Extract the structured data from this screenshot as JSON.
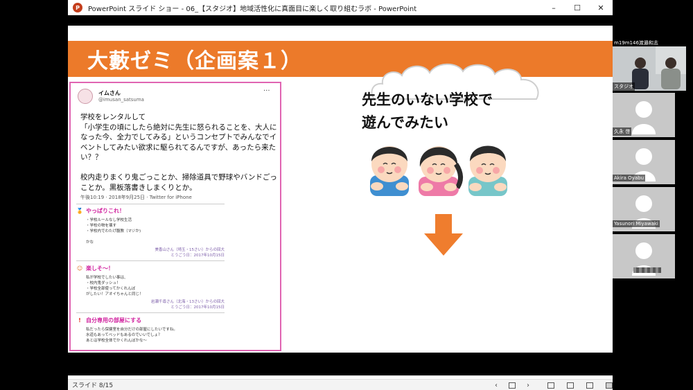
{
  "window": {
    "title": "PowerPoint スライド ショー  -  06_【スタジオ】地域活性化に真面目に楽しく取り組むラボ - PowerPoint",
    "logo_letter": "P",
    "minimize": "–",
    "maximize": "☐",
    "close": "✕"
  },
  "slide": {
    "title": "大藪ゼミ（企画案１）",
    "headline": "先生のいない学校で\n遊んでみたい"
  },
  "tweet": {
    "name": "イムさん",
    "handle": "@imusan_satsuma",
    "more": "···",
    "body": "学校をレンタルして\n「小学生の頃にしたら絶対に先生に怒られることを、大人になった今、全力でしてみる」というコンセプトでみんなでイベントしてみたい欲求に駆られてるんですが、あったら来たい？？\n\n校内走りまくり鬼ごっことか、掃除道具で野球やバンドごっことか。黒板落書きしまくりとか。",
    "meta": "午後10:19 · 2018年9月25日 · Twitter for iPhone",
    "answers": [
      {
        "head": "やっぱりこれ！",
        "icon": "🏅",
        "lines": "・学校ルールなし学校生活\n・学校の物を壊す\n・学校内でわたげ腹教（マジか)\n\nかな",
        "credit": "美香山さん（埼玉・15さい）からの回大\nとうごう日：2017年10月15日"
      },
      {
        "head": "楽しそ〜！",
        "icon": "☺",
        "lines": "私が学校でしたい事は、\n・校内鬼ダッシュ！\n・学校全部使ってかくれんぼ\nがしたい！アオイちゃんと同じ！",
        "credit": "岩瀬千尋さん（北海・13さい）からの回大\nとうごう日：2017年10月15日"
      },
      {
        "head": "自分専用の部屋にする",
        "icon": "!",
        "lines": "私だったら保健室を自分だけの部屋にしたいですね。\n水道もあってベッドもあるのでいいでしょ？\nあとは学校全体でかくれんぼかな〜",
        "credit": ""
      }
    ]
  },
  "statusbar": {
    "slide_label": "スライド 8/15",
    "prev": "‹",
    "next": "›"
  },
  "participants": {
    "top_name": "m19m146渡邉和志",
    "studio_label": "スタジオ",
    "tiles": [
      {
        "name": "久永 啓"
      },
      {
        "name": "Akira Oyabu"
      },
      {
        "name": "Yasunori Miyawaki"
      }
    ]
  },
  "colors": {
    "banner": "#ec7a2a",
    "tweet_border": "#e064b2",
    "answer_heading": "#d0239f",
    "arrow": "#ef7d2e"
  },
  "icons": [
    "powerpoint-logo-icon",
    "more-icon",
    "cloud-icon",
    "kids-illustration",
    "down-arrow-icon"
  ]
}
